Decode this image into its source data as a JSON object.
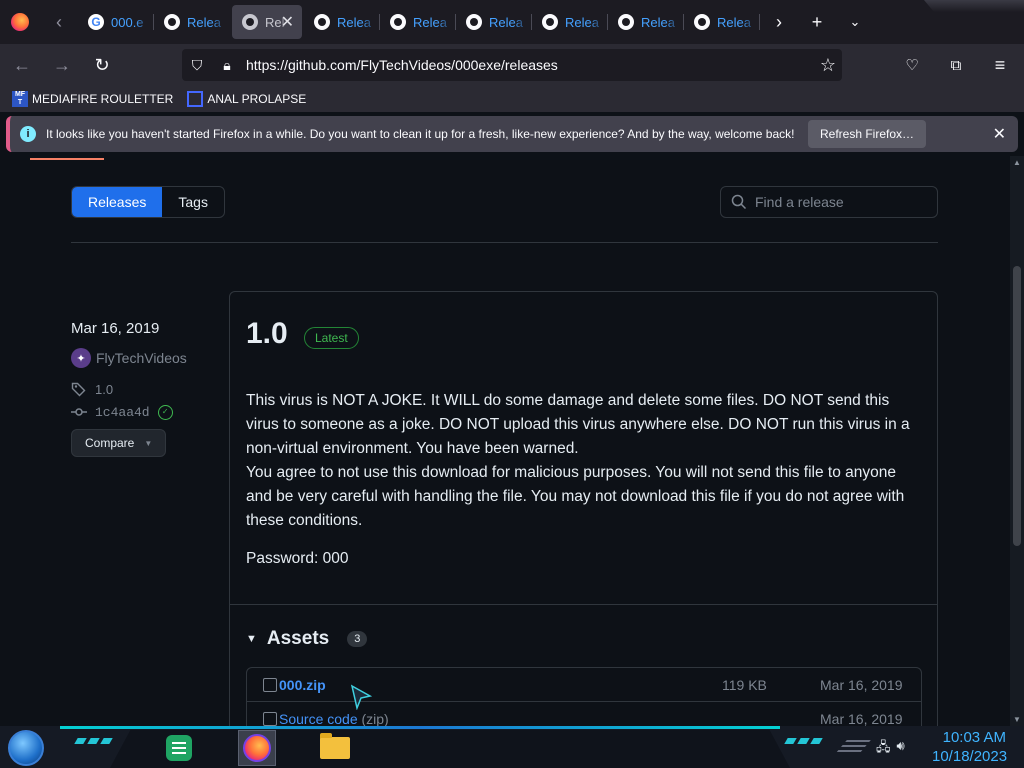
{
  "browser": {
    "tabs": [
      {
        "label": "000.e",
        "icon": "google-icon",
        "active": false
      },
      {
        "label": "Relea",
        "icon": "github-icon",
        "active": false
      },
      {
        "label": "Rel",
        "icon": "github-icon",
        "active": true
      },
      {
        "label": "Relea",
        "icon": "github-icon",
        "active": false
      },
      {
        "label": "Relea",
        "icon": "github-icon",
        "active": false
      },
      {
        "label": "Relea",
        "icon": "github-icon",
        "active": false
      },
      {
        "label": "Relea",
        "icon": "github-icon",
        "active": false
      },
      {
        "label": "Relea",
        "icon": "github-icon",
        "active": false
      },
      {
        "label": "Relea",
        "icon": "github-icon",
        "active": false
      }
    ],
    "url": "https://github.com/FlyTechVideos/000exe/releases",
    "bookmarks": [
      {
        "label": "MEDIAFIRE ROULETTER",
        "icon": "mediafire-icon",
        "icon_text": "MF T"
      },
      {
        "label": "ANAL PROLAPSE",
        "icon": "bookmark-icon"
      }
    ],
    "notification": {
      "text": "It looks like you haven't started Firefox in a while. Do you want to clean it up for a fresh, like-new experience? And by the way, welcome back!",
      "button": "Refresh Firefox…"
    }
  },
  "releases_page": {
    "tabs": [
      {
        "label": "Releases",
        "active": true
      },
      {
        "label": "Tags",
        "active": false
      }
    ],
    "search_placeholder": "Find a release",
    "release": {
      "date": "Mar 16, 2019",
      "author": "FlyTechVideos",
      "tag": "1.0",
      "commit": "1c4aa4d",
      "compare_label": "Compare",
      "title": "1.0",
      "badge": "Latest",
      "body": [
        "This virus is NOT A JOKE. It WILL do some damage and delete some files. DO NOT send this virus to someone as a joke. DO NOT upload this virus anywhere else. DO NOT run this virus in a non-virtual environment. You have been warned.",
        "You agree to not use this download for malicious purposes. You will not send this file to anyone and be very careful with handling the file. You may not download this file if you do not agree with these conditions."
      ],
      "password": "Password: 000",
      "assets_title": "Assets",
      "assets_count": "3",
      "assets": [
        {
          "name": "000.zip",
          "suffix": "",
          "size": "119 KB",
          "date": "Mar 16, 2019"
        },
        {
          "name": "Source code",
          "suffix": " (zip)",
          "size": "",
          "date": "Mar 16, 2019"
        }
      ]
    }
  },
  "taskbar": {
    "time": "10:03 AM",
    "date": "10/18/2023",
    "apps": [
      "sheets-icon",
      "firefox-icon",
      "file-explorer-icon"
    ]
  },
  "colors": {
    "accent": "#1f6feb",
    "link": "#4493f8",
    "latest": "#3fb950",
    "bg": "#0d1117"
  }
}
